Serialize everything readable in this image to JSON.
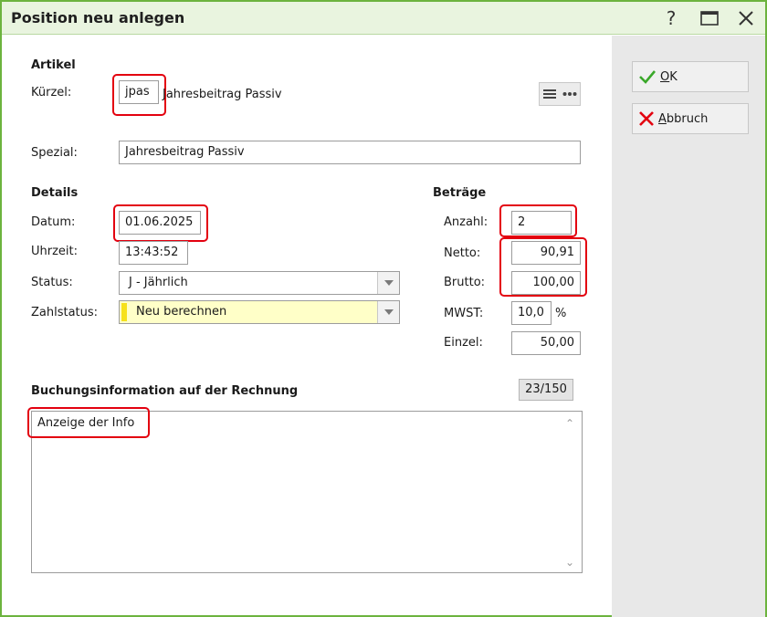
{
  "window": {
    "title": "Position neu anlegen"
  },
  "titlebar": {
    "help_glyph": "?"
  },
  "sidebar": {
    "ok": {
      "label_first": "O",
      "label_rest": "K"
    },
    "cancel": {
      "label_first": "A",
      "label_rest": "bbruch"
    }
  },
  "artikel": {
    "heading": "Artikel",
    "kuerzel_label": "Kürzel:",
    "kuerzel_value": "jpas",
    "kuerzel_name": "Jahresbeitrag Passiv",
    "spezial_label": "Spezial:",
    "spezial_value": "Jahresbeitrag Passiv"
  },
  "details": {
    "heading": "Details",
    "datum_label": "Datum:",
    "datum_value": "01.06.2025",
    "uhrzeit_label": "Uhrzeit:",
    "uhrzeit_value": "13:43:52",
    "status_label": "Status:",
    "status_value": "J - Jährlich",
    "zahlstatus_label": "Zahlstatus:",
    "zahlstatus_value": "Neu berechnen"
  },
  "betraege": {
    "heading": "Beträge",
    "anzahl_label": "Anzahl:",
    "anzahl_value": "2",
    "netto_label": "Netto:",
    "netto_value": "90,91",
    "brutto_label": "Brutto:",
    "brutto_value": "100,00",
    "mwst_label": "MWST:",
    "mwst_value": "10,0",
    "mwst_unit": "%",
    "einzel_label": "Einzel:",
    "einzel_value": "50,00"
  },
  "buchung": {
    "heading": "Buchungsinformation auf der Rechnung",
    "counter": "23/150",
    "text": "Anzeige der Info"
  },
  "colors": {
    "border_green": "#6cb33e",
    "highlight_red": "#e3000f",
    "ok_green": "#3aa82a",
    "cancel_red": "#e3000f",
    "zahlstatus_yellow": "#ffffc8"
  }
}
